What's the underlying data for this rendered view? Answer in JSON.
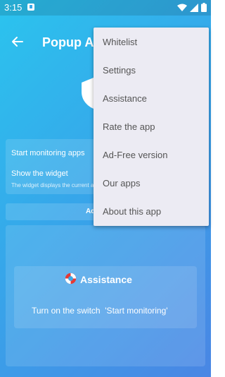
{
  "status_bar": {
    "time": "3:15"
  },
  "app_bar": {
    "title": "Popup Ad Blocker"
  },
  "settings": {
    "monitoring_label": "Start monitoring apps",
    "widget_label": "Show the widget",
    "widget_sub": "The widget displays the current app"
  },
  "ad_strip": {
    "text": "Ad"
  },
  "assistance_card": {
    "title": "Assistance",
    "description": "Turn on the switch  'Start monitoring'"
  },
  "menu": {
    "items": [
      {
        "label": "Whitelist"
      },
      {
        "label": "Settings"
      },
      {
        "label": "Assistance"
      },
      {
        "label": "Rate the app"
      },
      {
        "label": "Ad-Free version"
      },
      {
        "label": "Our apps"
      },
      {
        "label": "About this app"
      }
    ]
  },
  "colors": {
    "gradient_start": "#2bc4ee",
    "gradient_end": "#4a86e4",
    "menu_background": "#ecebf3",
    "menu_text": "#555555"
  },
  "icons": [
    "back-arrow-icon",
    "shield-icon",
    "lifebuoy-icon",
    "wifi-icon",
    "signal-icon",
    "battery-icon"
  ]
}
